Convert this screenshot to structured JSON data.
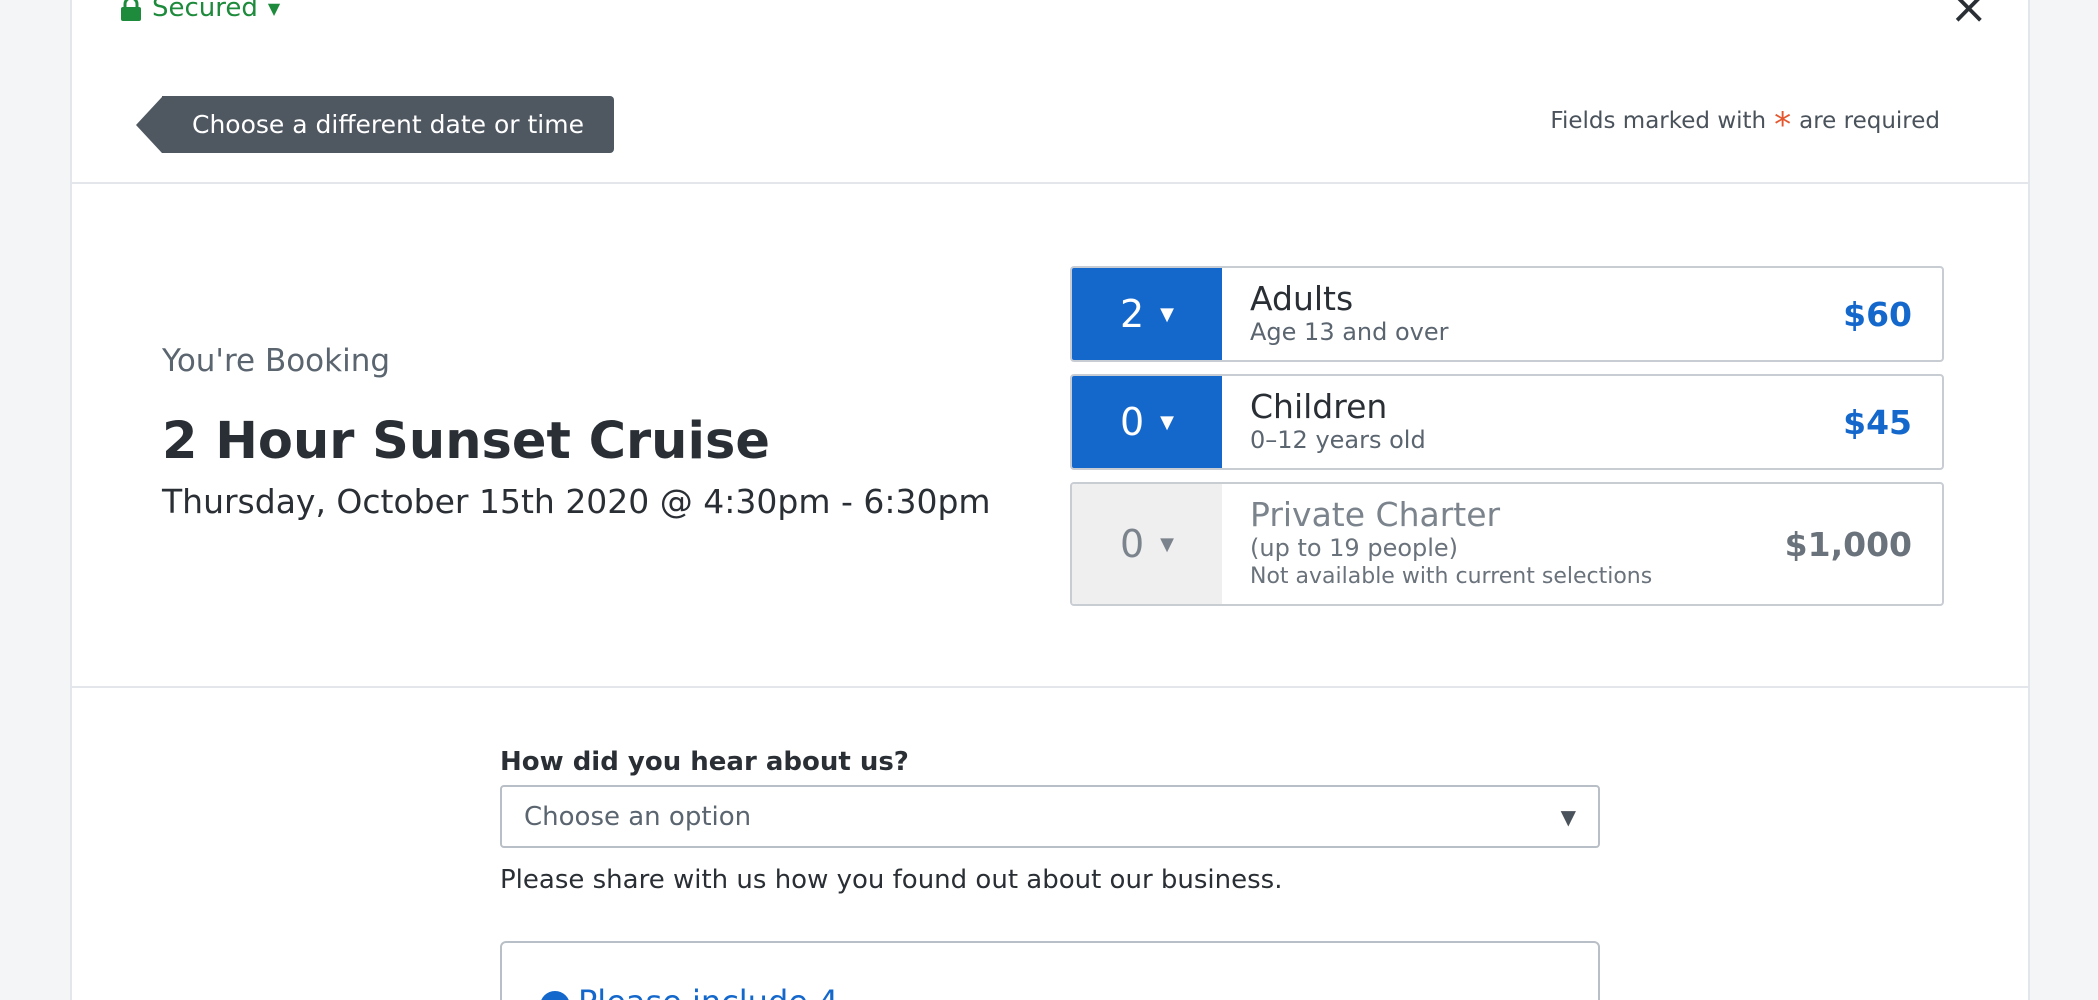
{
  "header": {
    "secured_label": "Secured",
    "back_button_label": "Choose a different date or time",
    "required_prefix": "Fields marked with",
    "required_asterisk": "*",
    "required_suffix": "are required",
    "close_icon": "×"
  },
  "booking": {
    "label": "You're Booking",
    "title": "2 Hour Sunset Cruise",
    "datetime": "Thursday, October 15th 2020 @ 4:30pm - 6:30pm"
  },
  "tickets": [
    {
      "qty": "2",
      "name": "Adults",
      "subtitle": "Age 13 and over",
      "note": "",
      "price": "$60",
      "state": "active"
    },
    {
      "qty": "0",
      "name": "Children",
      "subtitle": "0–12 years old",
      "note": "",
      "price": "$45",
      "state": "active"
    },
    {
      "qty": "0",
      "name": "Private Charter",
      "subtitle": "(up to 19 people)",
      "note": "Not available with current selections",
      "price": "$1,000",
      "state": "disabled"
    }
  ],
  "referral": {
    "label": "How did you hear about us?",
    "placeholder": "Choose an option",
    "help_text": "Please share with us how you found out about our business."
  },
  "notice": {
    "text": "Please include 4"
  },
  "colors": {
    "accent": "#1468cc",
    "secured": "#1e8a3c",
    "asterisk": "#e4572e",
    "tag": "#4f5761"
  },
  "icons": {
    "lock": "lock-icon",
    "close": "close-icon",
    "caret": "caret-down-icon",
    "info": "info-icon"
  }
}
